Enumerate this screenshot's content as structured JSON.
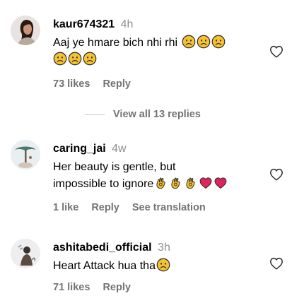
{
  "comments": [
    {
      "username": "kaur674321",
      "time": "4h",
      "text_line1": "Aaj ye hmare bich nhi rhi",
      "likes": "73 likes",
      "reply": "Reply"
    },
    {
      "username": "caring_jai",
      "time": "4w",
      "text_line1": "Her beauty is gentle, but",
      "text_line2": "impossible to ignore",
      "likes": "1 like",
      "reply": "Reply",
      "translate": "See translation"
    },
    {
      "username": "ashitabedi_official",
      "time": "3h",
      "text_line1": "Heart Attack hua tha",
      "likes": "71 likes",
      "reply": "Reply"
    }
  ],
  "view_replies": "View all 13 replies",
  "colors": {
    "muted": "#737373",
    "time": "#8e8e8e",
    "emoji_face": "#f7c230",
    "heart_red": "#e0245e"
  },
  "icons": {
    "like": "heart-outline-icon",
    "sad": "sad-face-emoji",
    "ok_hand": "ok-hand-emoji",
    "red_heart": "red-heart-emoji"
  }
}
